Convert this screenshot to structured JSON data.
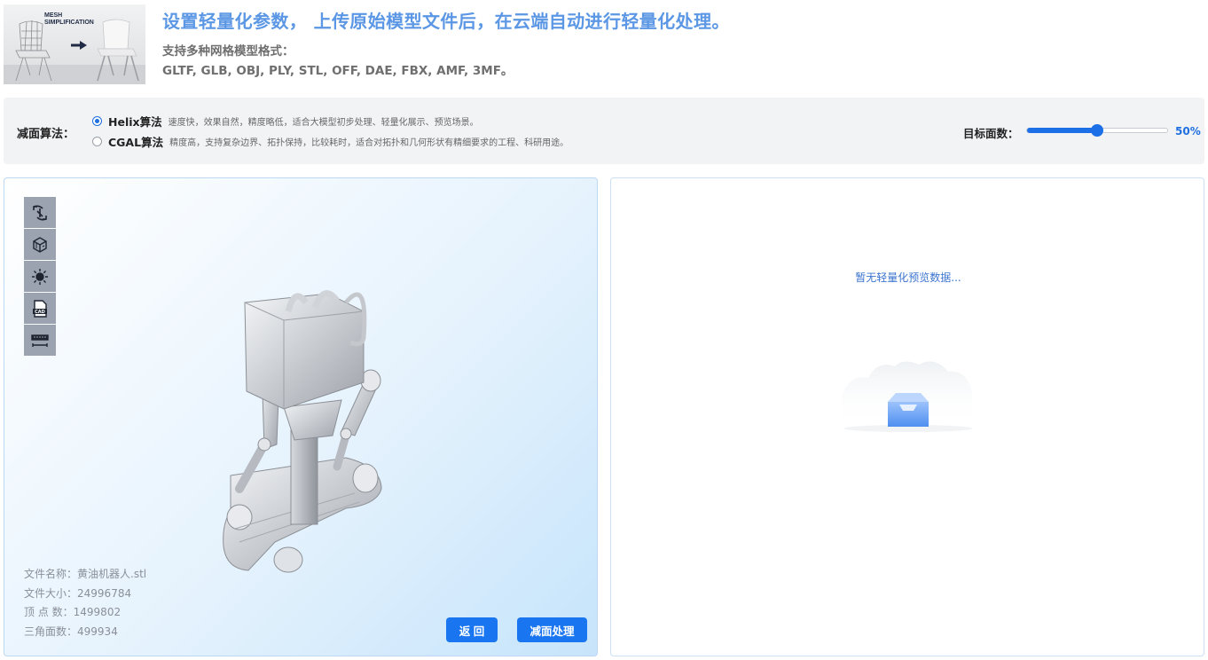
{
  "header": {
    "banner": {
      "line1": "MESH",
      "line2": "SIMPLIFICATION"
    },
    "headline": "设置轻量化参数， 上传原始模型文件后，在云端自动进行轻量化处理。",
    "formats_title": "支持多种网格模型格式：",
    "formats_list": "GLTF, GLB, OBJ, PLY, STL, OFF, DAE, FBX, AMF, 3MF。"
  },
  "settings": {
    "algorithm_label": "减面算法：",
    "options": [
      {
        "name": "Helix算法",
        "desc": "速度快，效果自然，精度略低，适合大模型初步处理、轻量化展示、预览场景。",
        "selected": true
      },
      {
        "name": "CGAL算法",
        "desc": "精度高，支持复杂边界、拓扑保持，比较耗时，适合对拓扑和几何形状有精细要求的工程、科研用途。",
        "selected": false
      }
    ],
    "target_label": "目标面数：",
    "target_percent": 50,
    "target_value_text": "50%"
  },
  "viewer": {
    "tools": [
      "rotate-view-icon",
      "cube-view-icon",
      "light-icon",
      "cad-file-icon",
      "measure-ruler-icon"
    ],
    "file_info": {
      "name_label": "文件名称：",
      "name": "黄油机器人.stl",
      "size_label": "文件大小：",
      "size": "24996784",
      "vertices_label": "顶 点 数：",
      "vertices": "1499802",
      "faces_label": "三角面数：",
      "faces": "499934"
    },
    "back_button": "返 回",
    "reduce_button": "减面处理"
  },
  "preview": {
    "empty_text": "暂无轻量化预览数据..."
  },
  "colors": {
    "accent": "#1976f0",
    "headline": "#5b97e4",
    "settings_bg": "#f2f3f5"
  }
}
